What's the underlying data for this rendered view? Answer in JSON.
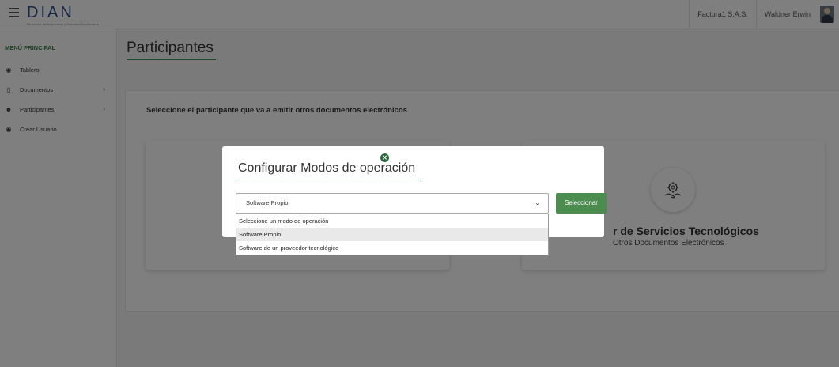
{
  "header": {
    "logo_text": "DIAN",
    "logo_subtext": "Dirección de Impuestos y Aduanas Nacionales",
    "company": "Factura1 S.A.S.",
    "user": "Waldner Erwin"
  },
  "sidebar": {
    "title": "MENÚ PRINCIPAL",
    "items": [
      {
        "label": "Tablero",
        "icon": "dashboard-icon",
        "has_submenu": false
      },
      {
        "label": "Documentos",
        "icon": "inbox-icon",
        "has_submenu": true
      },
      {
        "label": "Participantes",
        "icon": "users-icon",
        "has_submenu": true
      },
      {
        "label": "Crear Usuario",
        "icon": "user-circle-icon",
        "has_submenu": false
      }
    ]
  },
  "main": {
    "page_title": "Participantes",
    "card_heading": "Seleccione el participante que va a emitir otros documentos electrónicos",
    "option_right": {
      "title": "r de Servicios Tecnológicos",
      "subtitle": "Otros Documentos Electrónicos",
      "icon": "tech-provider-icon"
    }
  },
  "modal": {
    "title": "Configurar Modos de operación",
    "selected_value": "Software Propio",
    "button_label": "Seleccionar",
    "options": [
      "Seleccione un modo de operación",
      "Software Propio",
      "Software de un proveedor tecnológico"
    ],
    "accent_color": "#4c8c4f"
  }
}
